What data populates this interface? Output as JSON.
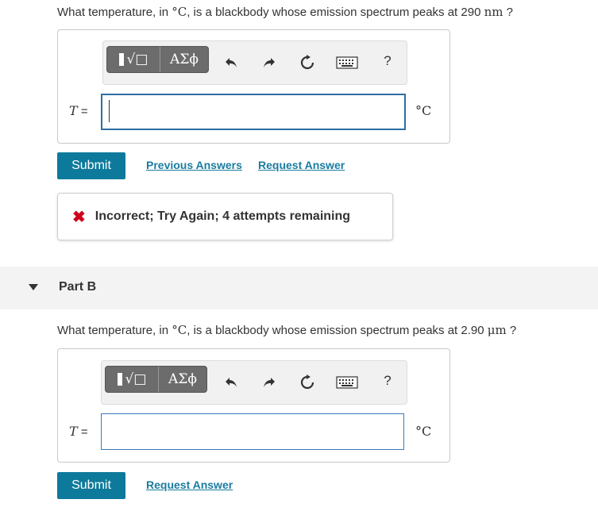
{
  "partA": {
    "question_prefix": "What temperature, in ",
    "question_unit": "°C",
    "question_middle": ", is a blackbody whose emission spectrum peaks at 290 ",
    "question_value_unit": "nm",
    "question_suffix": " ?",
    "toolbar": {
      "templates_label": "√□",
      "greek_label": "ΑΣϕ",
      "help_label": "?"
    },
    "variable": "T",
    "equals": " =",
    "input_value": "",
    "unit": "°C",
    "submit_label": "Submit",
    "previous_answers_label": "Previous Answers",
    "request_answer_label": "Request Answer",
    "feedback_icon": "✖",
    "feedback_text": "Incorrect; Try Again; 4 attempts remaining"
  },
  "partB": {
    "title": "Part B",
    "question_prefix": "What temperature, in ",
    "question_unit": "°C",
    "question_middle": ", is a blackbody whose emission spectrum peaks at 2.90 ",
    "question_value_unit": "μm",
    "question_suffix": " ?",
    "toolbar": {
      "templates_label": "√□",
      "greek_label": "ΑΣϕ",
      "help_label": "?"
    },
    "variable": "T",
    "equals": " =",
    "input_value": "",
    "unit": "°C",
    "submit_label": "Submit",
    "request_answer_label": "Request Answer"
  },
  "colors": {
    "submit_bg": "#0e7a9b",
    "link": "#1a7ca0",
    "error": "#d0021b",
    "input_border": "#2e6da4"
  }
}
